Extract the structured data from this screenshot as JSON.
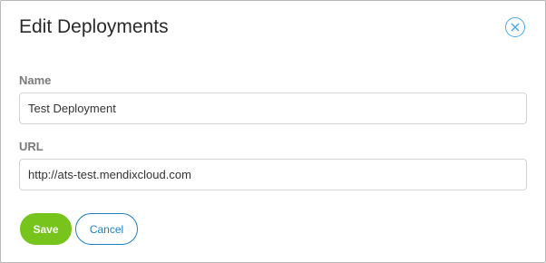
{
  "dialog": {
    "title": "Edit Deployments",
    "close_icon": "close-icon"
  },
  "form": {
    "name": {
      "label": "Name",
      "value": "Test Deployment"
    },
    "url": {
      "label": "URL",
      "value": "http://ats-test.mendixcloud.com"
    }
  },
  "actions": {
    "save_label": "Save",
    "cancel_label": "Cancel"
  },
  "colors": {
    "save_button": "#76c41c",
    "cancel_button": "#1f7fc0",
    "close_icon": "#4aa8e0"
  }
}
